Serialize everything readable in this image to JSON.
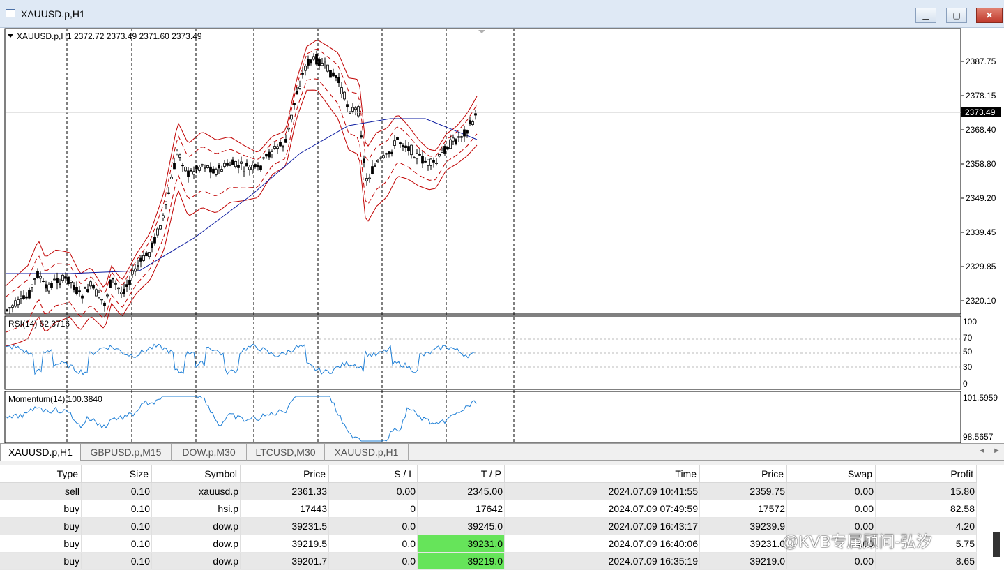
{
  "window": {
    "title": "XAUUSD.p,H1",
    "minimize": "▁",
    "maximize": "▢",
    "close": "✕"
  },
  "chart": {
    "header": "XAUUSD.p,H1  2372.72 2373.49 2371.60 2373.49",
    "price_labels": [
      "2387.75",
      "2378.15",
      "2368.40",
      "2358.80",
      "2349.20",
      "2339.45",
      "2329.85",
      "2320.10"
    ],
    "current_price": "2373.49",
    "rsi_label": "RSI(14) 62.3716",
    "rsi_levels": [
      "100",
      "70",
      "50",
      "30",
      "0"
    ],
    "momentum_label": "Momentum(14) 100.3840",
    "momentum_levels": [
      "101.5959",
      "98.5657"
    ],
    "colors": {
      "candles": "#000000",
      "bands": "#c00000",
      "ma": "#0a1aa0",
      "rsi": "#1e7fd6",
      "momentum": "#1e7fd6",
      "last_price_bg": "#000000"
    }
  },
  "tabs": [
    {
      "label": "XAUUSD.p,H1",
      "active": true
    },
    {
      "label": "GBPUSD.p,M15",
      "active": false
    },
    {
      "label": "DOW.p,M30",
      "active": false
    },
    {
      "label": "LTCUSD,M30",
      "active": false
    },
    {
      "label": "XAUUSD.p,H1",
      "active": false
    }
  ],
  "tab_nav": {
    "prev": "◄",
    "next": "►"
  },
  "orders": {
    "columns": [
      "Type",
      "Size",
      "Symbol",
      "Price",
      "S / L",
      "T / P",
      "Time",
      "Price",
      "Swap",
      "Profit"
    ],
    "rows": [
      {
        "type": "sell",
        "size": "0.10",
        "symbol": "xauusd.p",
        "price": "2361.33",
        "sl": "0.00",
        "tp": "2345.00",
        "time": "2024.07.09 10:41:55",
        "cur_price": "2359.75",
        "swap": "0.00",
        "profit": "15.80",
        "tp_hit": false
      },
      {
        "type": "buy",
        "size": "0.10",
        "symbol": "hsi.p",
        "price": "17443",
        "sl": "0",
        "tp": "17642",
        "time": "2024.07.09 07:49:59",
        "cur_price": "17572",
        "swap": "0.00",
        "profit": "82.58",
        "tp_hit": false
      },
      {
        "type": "buy",
        "size": "0.10",
        "symbol": "dow.p",
        "price": "39231.5",
        "sl": "0.0",
        "tp": "39245.0",
        "time": "2024.07.09 16:43:17",
        "cur_price": "39239.9",
        "swap": "0.00",
        "profit": "4.20",
        "tp_hit": false
      },
      {
        "type": "buy",
        "size": "0.10",
        "symbol": "dow.p",
        "price": "39219.5",
        "sl": "0.0",
        "tp": "39231.0",
        "time": "2024.07.09 16:40:06",
        "cur_price": "39231.0",
        "swap": "0.00",
        "profit": "5.75",
        "tp_hit": true
      },
      {
        "type": "buy",
        "size": "0.10",
        "symbol": "dow.p",
        "price": "39201.7",
        "sl": "0.0",
        "tp": "39219.0",
        "time": "2024.07.09 16:35:19",
        "cur_price": "39219.0",
        "swap": "0.00",
        "profit": "8.65",
        "tp_hit": true
      }
    ]
  },
  "watermark": "@KVB专属顾问-弘汐"
}
